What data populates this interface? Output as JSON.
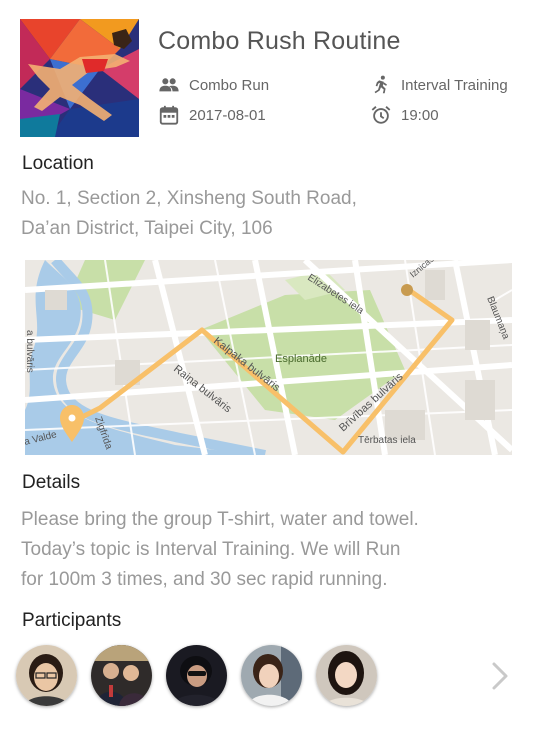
{
  "event": {
    "title": "Combo Rush Routine",
    "category": "Combo Run",
    "type": "Interval Training",
    "date": "2017-08-01",
    "time": "19:00"
  },
  "location": {
    "heading": "Location",
    "address_line1": "No. 1, Section 2, Xinsheng South Road,",
    "address_line2": "Da’an District, Taipei City, 106"
  },
  "map": {
    "labels": {
      "elizabetes": "Elizabetes iela",
      "esplanade": "Esplanāde",
      "kalpaka": "Kalpaka bulvāris",
      "raina": "Raiņa bulvāris",
      "brivibas": "Brīvības bulvāris",
      "terbatas": "Tērbatas iela",
      "blaumana": "Blaumaņa",
      "valde": "a Valde",
      "zigfrida": "Zigfrīda",
      "bulvaris_left": "a bulvāris",
      "iznicas": "Iznicas"
    },
    "route_color": "#f8c069"
  },
  "details": {
    "heading": "Details",
    "lines": [
      "Please bring the group T-shirt, water and towel.",
      "Today’s topic is Interval Training. We will Run",
      "for 100m 3 times, and 30 sec rapid running."
    ]
  },
  "participants": {
    "heading": "Participants"
  },
  "icons": {
    "group": "group-icon",
    "runner": "runner-icon",
    "calendar": "calendar-icon",
    "alarm": "alarm-clock-icon",
    "chevron": "chevron-right-icon"
  }
}
